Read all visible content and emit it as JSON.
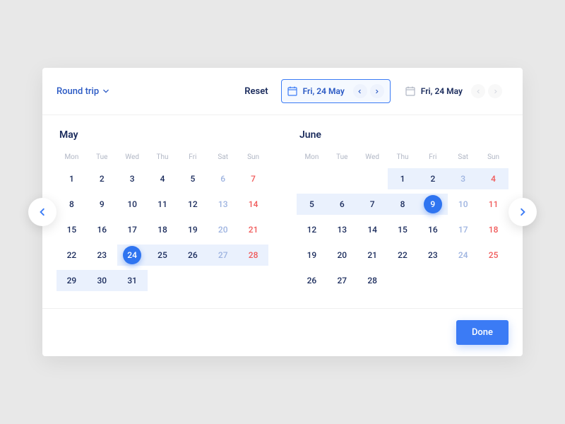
{
  "header": {
    "trip_type_label": "Round trip",
    "reset_label": "Reset",
    "depart_date": "Fri, 24 May",
    "return_date": "Fri, 24 May"
  },
  "dow": [
    "Mon",
    "Tue",
    "Wed",
    "Thu",
    "Fri",
    "Sat",
    "Sun"
  ],
  "month_left": {
    "title": "May",
    "days": [
      {
        "n": 1
      },
      {
        "n": 2
      },
      {
        "n": 3
      },
      {
        "n": 4
      },
      {
        "n": 5
      },
      {
        "n": 6,
        "sat": true
      },
      {
        "n": 7,
        "sun": true
      },
      {
        "n": 8
      },
      {
        "n": 9
      },
      {
        "n": 10
      },
      {
        "n": 11
      },
      {
        "n": 12
      },
      {
        "n": 13,
        "sat": true
      },
      {
        "n": 14,
        "sun": true
      },
      {
        "n": 15
      },
      {
        "n": 16
      },
      {
        "n": 17
      },
      {
        "n": 18
      },
      {
        "n": 19
      },
      {
        "n": 20,
        "sat": true
      },
      {
        "n": 21,
        "sun": true
      },
      {
        "n": 22
      },
      {
        "n": 23
      },
      {
        "n": 24,
        "sel": true,
        "range": true
      },
      {
        "n": 25,
        "range": true
      },
      {
        "n": 26,
        "range": true
      },
      {
        "n": 27,
        "sat": true,
        "range": true
      },
      {
        "n": 28,
        "sun": true,
        "range": true
      },
      {
        "n": 29,
        "range": true
      },
      {
        "n": 30,
        "range": true
      },
      {
        "n": 31,
        "range": true
      }
    ]
  },
  "month_right": {
    "title": "June",
    "leading_blanks": 3,
    "days": [
      {
        "n": 1,
        "range": true
      },
      {
        "n": 2,
        "range": true
      },
      {
        "n": 3,
        "sat": true,
        "range": true
      },
      {
        "n": 4,
        "sun": true,
        "range": true
      },
      {
        "n": 5,
        "range": true
      },
      {
        "n": 6,
        "range": true
      },
      {
        "n": 7,
        "range": true
      },
      {
        "n": 8,
        "range": true
      },
      {
        "n": 9,
        "sel": true,
        "range": true
      },
      {
        "n": 10,
        "sat": true
      },
      {
        "n": 11,
        "sun": true
      },
      {
        "n": 12
      },
      {
        "n": 13
      },
      {
        "n": 14
      },
      {
        "n": 15
      },
      {
        "n": 16
      },
      {
        "n": 17,
        "sat": true
      },
      {
        "n": 18,
        "sun": true
      },
      {
        "n": 19
      },
      {
        "n": 20
      },
      {
        "n": 21
      },
      {
        "n": 22
      },
      {
        "n": 23
      },
      {
        "n": 24,
        "sat": true
      },
      {
        "n": 25,
        "sun": true
      },
      {
        "n": 26
      },
      {
        "n": 27
      },
      {
        "n": 28
      }
    ]
  },
  "footer": {
    "done_label": "Done"
  }
}
